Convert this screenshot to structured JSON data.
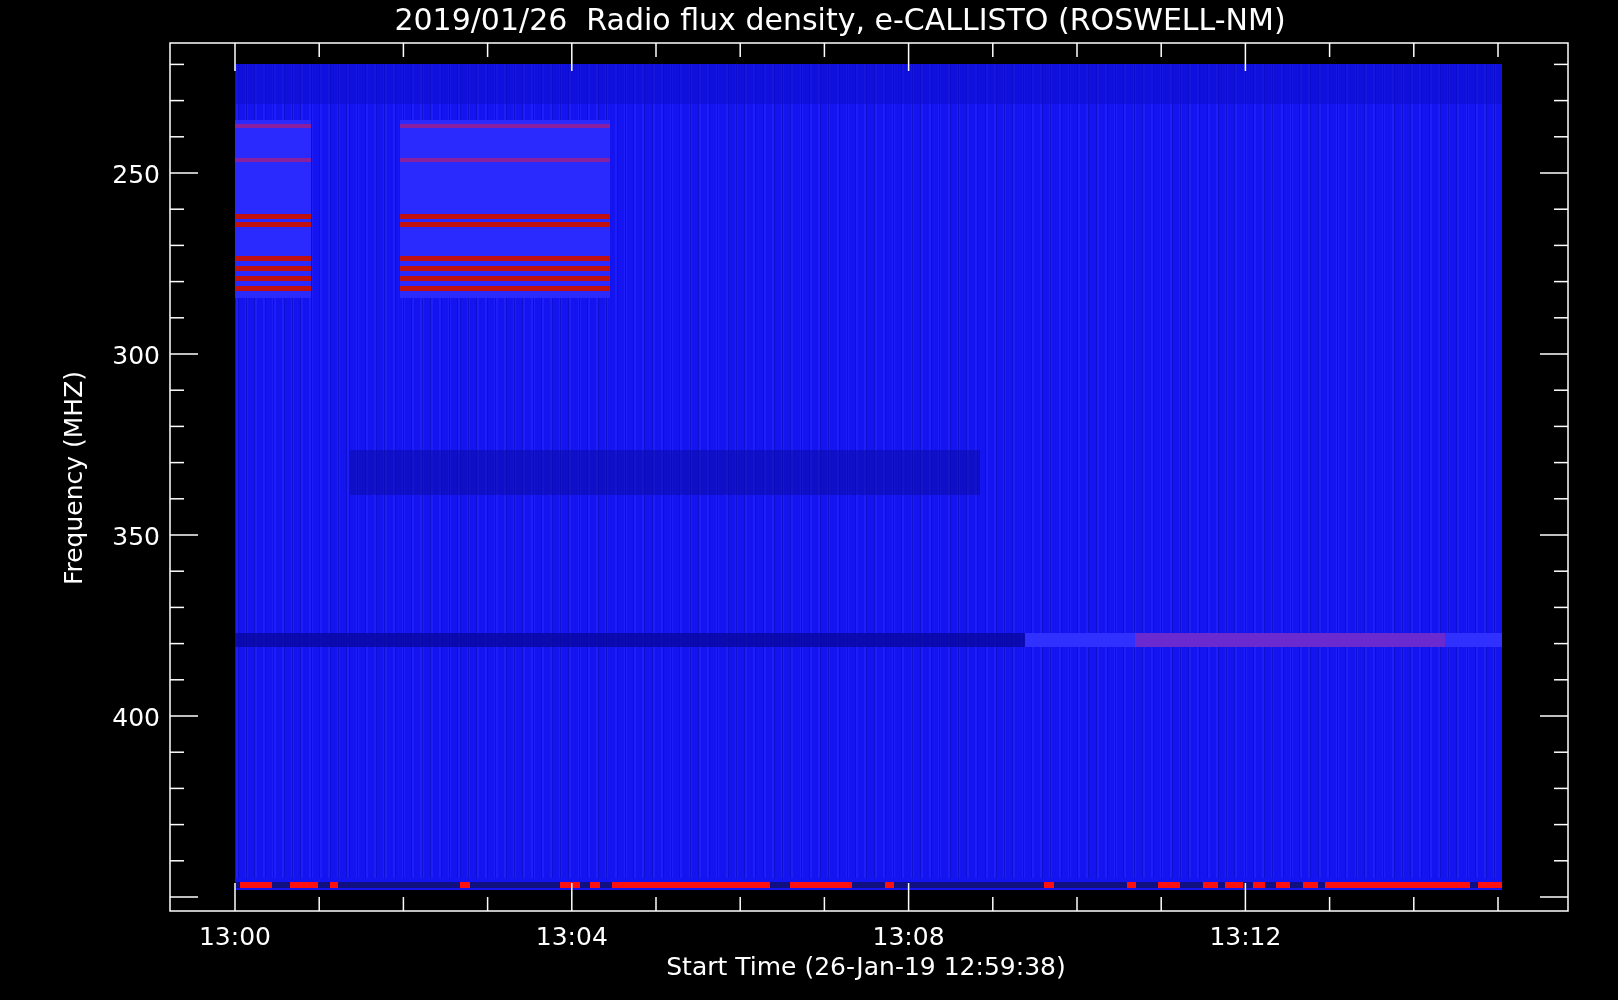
{
  "title": "2019/01/26  Radio flux density, e-CALLISTO (ROSWELL-NM)",
  "ylabel": "Frequency (MHZ)",
  "xlabel": "Start Time (26-Jan-19 12:59:38)",
  "yticks": [
    "250",
    "300",
    "350",
    "400"
  ],
  "xticks": [
    "13:00",
    "13:04",
    "13:08",
    "13:12"
  ]
}
